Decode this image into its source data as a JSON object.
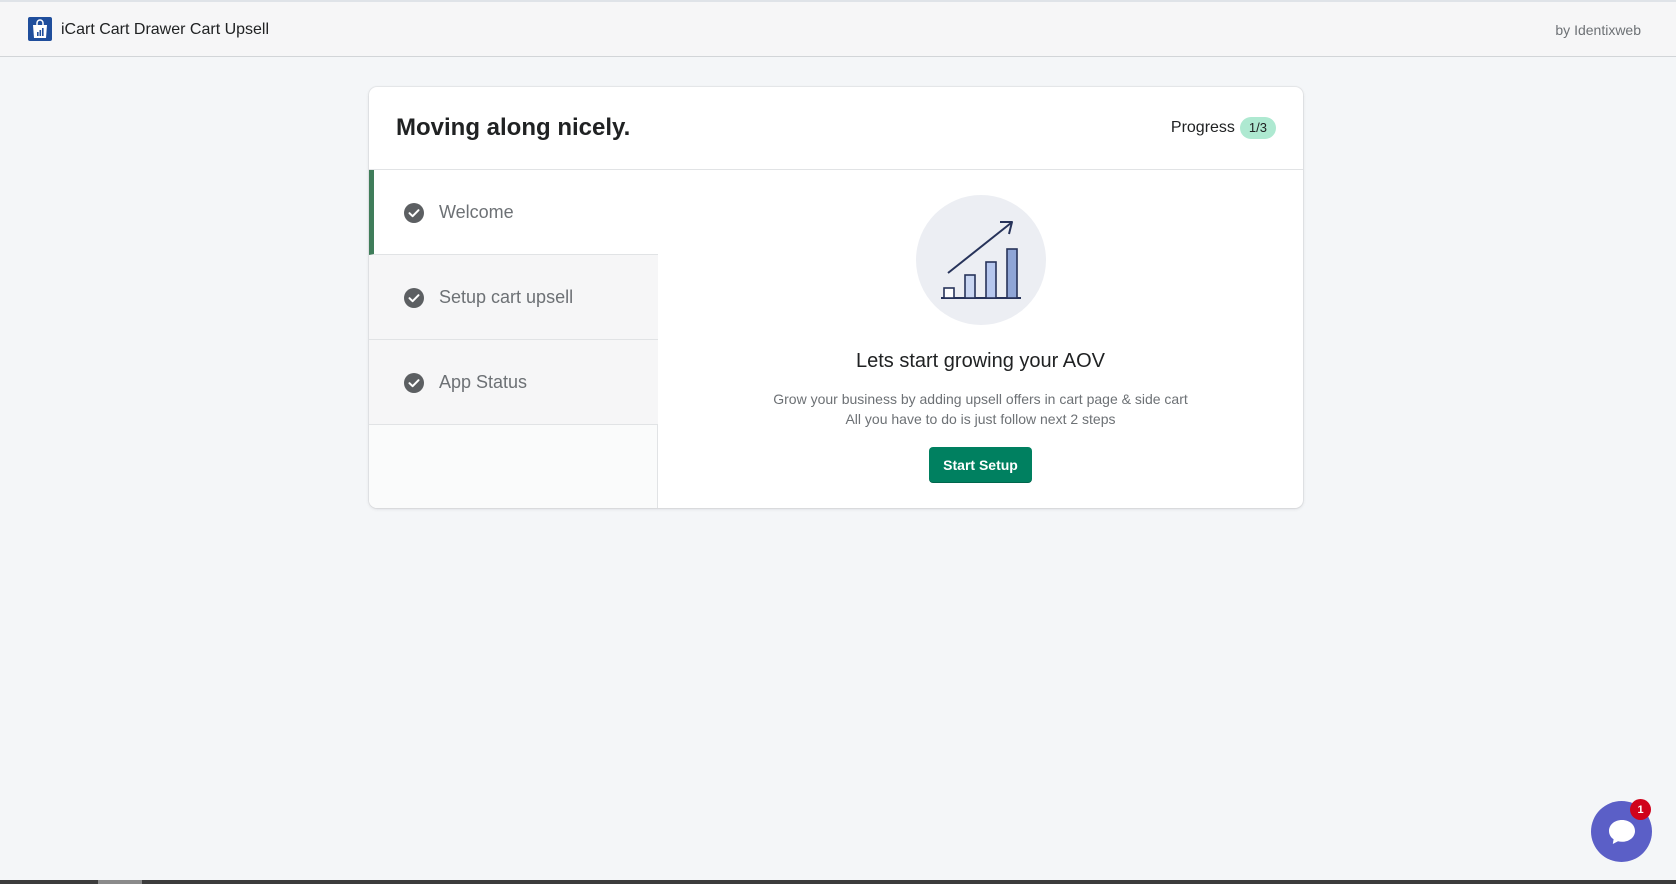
{
  "topbar": {
    "app_title": "iCart Cart Drawer Cart Upsell",
    "by_text": "by Identixweb",
    "logo_icon": "shopping-bag-icon",
    "logo_color": "#1f4e9c"
  },
  "card": {
    "title": "Moving along nicely.",
    "progress_label": "Progress",
    "progress_value": "1/3",
    "progress_badge_color": "#aee9d1"
  },
  "steps": [
    {
      "label": "Welcome",
      "icon": "check-circle-icon",
      "active": true
    },
    {
      "label": "Setup cart upsell",
      "icon": "check-circle-icon",
      "active": false
    },
    {
      "label": "App Status",
      "icon": "check-circle-icon",
      "active": false
    }
  ],
  "content": {
    "illustration_icon": "growth-chart-icon",
    "heading": "Lets start growing your AOV",
    "line1": "Grow your business by adding upsell offers in cart page & side cart",
    "line2": "All you have to do is just follow next 2 steps",
    "button_label": "Start Setup",
    "button_color": "#008060"
  },
  "chat": {
    "icon": "chat-bubble-icon",
    "badge_count": "1",
    "color": "#5b5fc7"
  }
}
